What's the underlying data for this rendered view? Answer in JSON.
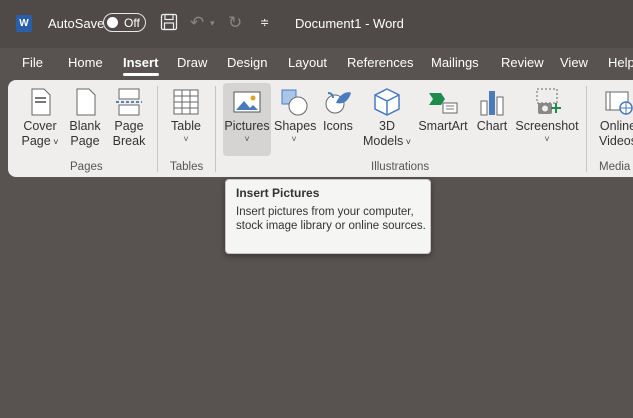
{
  "titlebar": {
    "logo_letter": "W",
    "autosave_label": "AutoSave",
    "toggle_state": "Off",
    "save_icon": "save-icon",
    "undo_icon": "undo-icon",
    "redo_icon": "redo-icon",
    "customize_icon": "customize-quick-access-icon",
    "document_title": "Document1  -  Word"
  },
  "tabs": [
    "File",
    "Home",
    "Insert",
    "Draw",
    "Design",
    "Layout",
    "References",
    "Mailings",
    "Review",
    "View",
    "Help"
  ],
  "active_tab": "Insert",
  "ribbon": {
    "groups": {
      "pages": "Pages",
      "tables": "Tables",
      "illustrations": "Illustrations",
      "media": "Media"
    },
    "buttons": {
      "cover_page": {
        "line1": "Cover",
        "line2": "Page"
      },
      "blank_page": {
        "line1": "Blank",
        "line2": "Page"
      },
      "page_break": {
        "line1": "Page",
        "line2": "Break"
      },
      "table": {
        "line1": "Table"
      },
      "pictures": {
        "line1": "Pictures"
      },
      "shapes": {
        "line1": "Shapes"
      },
      "icons": {
        "line1": "Icons"
      },
      "models_3d": {
        "line1": "3D",
        "line2": "Models"
      },
      "smartart": {
        "line1": "SmartArt"
      },
      "chart": {
        "line1": "Chart"
      },
      "screenshot": {
        "line1": "Screenshot"
      },
      "online_videos": {
        "line1": "Online",
        "line2": "Videos"
      }
    }
  },
  "tooltip": {
    "title": "Insert Pictures",
    "body": "Insert pictures from your computer, stock image library or online sources."
  },
  "colors": {
    "background": "#585250",
    "titlebar": "#4f4a48",
    "ribbon": "#efeeed",
    "word_blue": "#2b5ea8",
    "smartart_green": "#1e8a4b",
    "chart_blue": "#4a7bbf"
  }
}
